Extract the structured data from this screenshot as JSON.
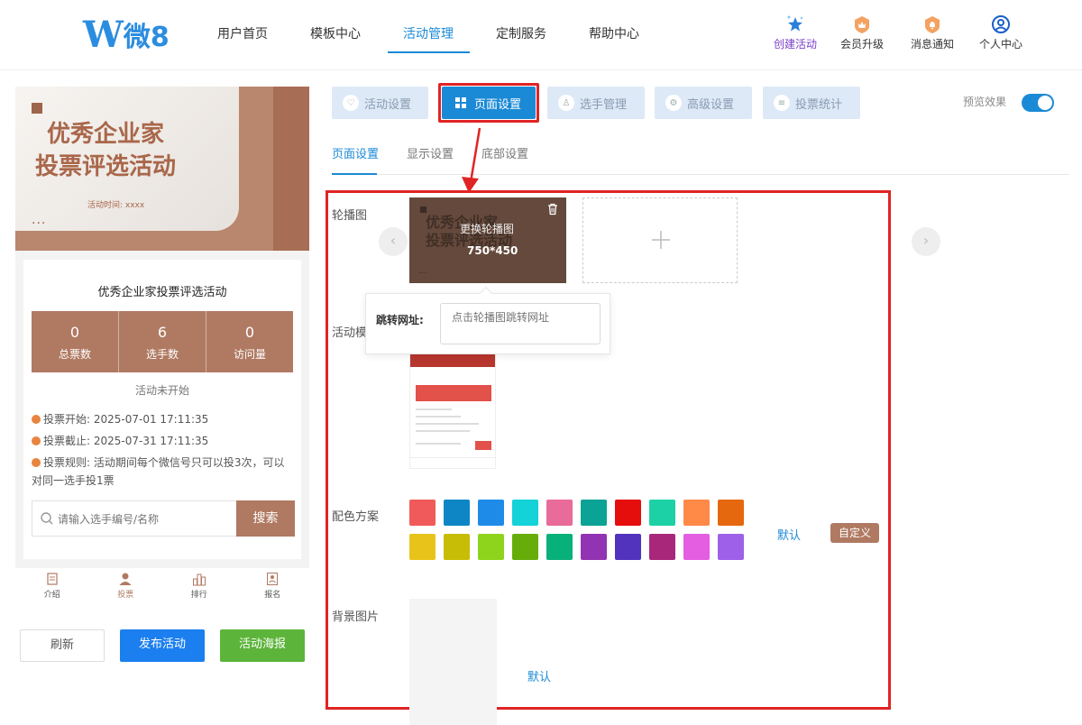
{
  "brand": {
    "logo_mark": "W",
    "logo_text": "微8"
  },
  "nav": {
    "items": [
      "用户首页",
      "模板中心",
      "活动管理",
      "定制服务",
      "帮助中心"
    ],
    "active_index": 2,
    "right": [
      "创建活动",
      "会员升级",
      "消息通知",
      "个人中心"
    ],
    "icons": [
      "sparkle-star-icon",
      "crown-badge-icon",
      "bell-badge-icon",
      "user-circle-icon"
    ]
  },
  "preview": {
    "banner": {
      "title_line1": "优秀企业家",
      "title_line2": "投票评选活动",
      "time": "活动时间: xxxx",
      "dots": "..."
    },
    "card_title": "优秀企业家投票评选活动",
    "stats": [
      {
        "value": "0",
        "label": "总票数"
      },
      {
        "value": "6",
        "label": "选手数"
      },
      {
        "value": "0",
        "label": "访问量"
      }
    ],
    "status": "活动未开始",
    "info": [
      "投票开始: 2025-07-01 17:11:35",
      "投票截止: 2025-07-31 17:11:35",
      "投票规则: 活动期间每个微信号只可以投3次，可以对同一选手投1票"
    ],
    "search": {
      "placeholder": "请输入选手编号/名称",
      "button": "搜索"
    },
    "tabbar": [
      "介绍",
      "投票",
      "排行",
      "报名"
    ],
    "tabbar_active": 1
  },
  "actions": {
    "refresh": "刷新",
    "publish": "发布活动",
    "poster": "活动海报"
  },
  "right": {
    "tabs": [
      "活动设置",
      "页面设置",
      "选手管理",
      "高级设置",
      "投票统计"
    ],
    "active_tab": 1,
    "preview_label": "预览效果",
    "preview_toggle": true,
    "subtabs": [
      "页面设置",
      "显示设置",
      "底部设置"
    ],
    "active_subtab": 0
  },
  "form": {
    "carousel_label": "轮播图",
    "carousel": {
      "thumb_line1": "优秀企业家",
      "thumb_line2": "投票评选活动",
      "change": "更换轮播图",
      "size": "750*450"
    },
    "prev_btn": "‹",
    "next_btn": "›",
    "template_label": "活动模",
    "popover": {
      "label": "跳转网址:",
      "placeholder": "点击轮播图跳转网址"
    },
    "color_label": "配色方案",
    "colors_row1": [
      "#f05a5a",
      "#0e86c6",
      "#1f8be8",
      "#13d2d8",
      "#e96b99",
      "#0aa395",
      "#e60d0d",
      "#1dd1a6",
      "#ff8947",
      "#e6680e"
    ],
    "colors_row2": [
      "#e8c41a",
      "#c8bd06",
      "#8ed41c",
      "#66ad0a",
      "#08b07a",
      "#9233b3",
      "#5133bd",
      "#a8277a",
      "#e35ee0",
      "#9e60e8"
    ],
    "color_default": "默认",
    "color_custom": "自定义",
    "bg_label": "背景图片",
    "bg_default": "默认"
  },
  "theme": {
    "accent": "#1b8ad6",
    "brand": "#b07a62",
    "highlight": "#e02424",
    "publish": "#1b7ff0",
    "poster": "#5cb43a"
  }
}
